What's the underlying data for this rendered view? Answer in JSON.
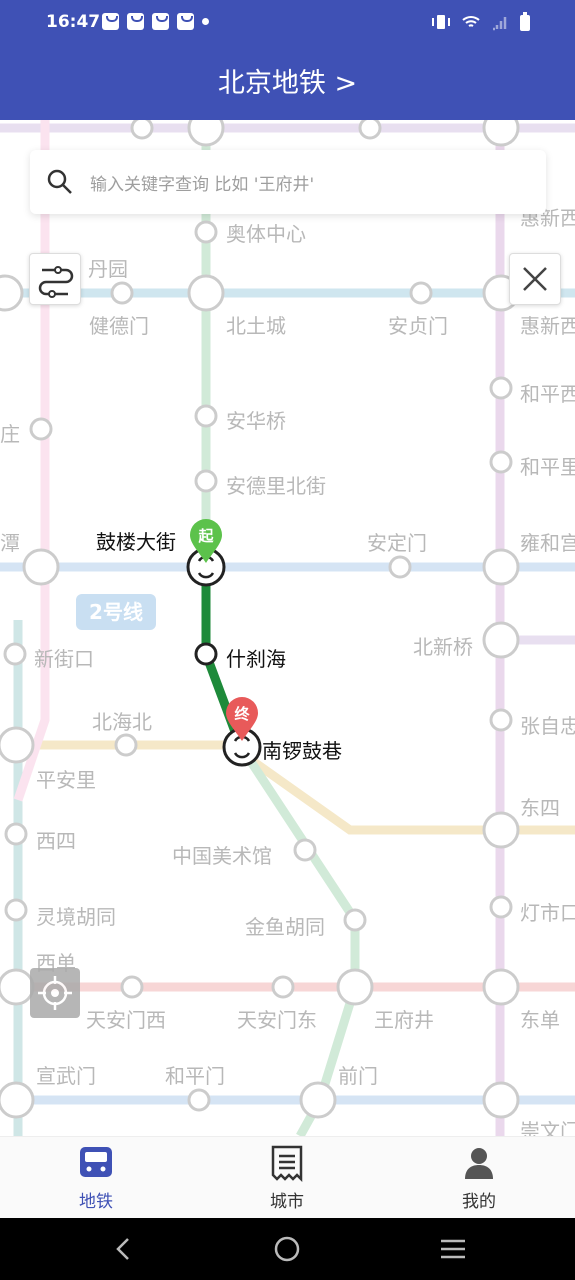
{
  "status": {
    "time": "16:47"
  },
  "header": {
    "title": "北京地铁 >"
  },
  "search": {
    "placeholder": "输入关键字查询 比如 '王府井'"
  },
  "line_badge": "2号线",
  "route": {
    "start_tag": "起",
    "end_tag": "终",
    "start": "鼓楼大街",
    "middle": "什刹海",
    "end": "南锣鼓巷"
  },
  "stations": {
    "aotizhongxin": "奥体中心",
    "mudanyuan": "丹园",
    "jiandemen": "健德门",
    "beitucheng": "北土城",
    "anzhenmen": "安贞门",
    "huixinxi": "惠新西",
    "huixindong": "惠新西",
    "anhuaqiao": "安华桥",
    "heping1": "和平西",
    "heping2": "和平里",
    "zhuang": "庄",
    "andelibeijie": "安德里北街",
    "tan": "潭",
    "andingmen": "安定门",
    "yonghegong": "雍和宫",
    "xinjiekou": "新街口",
    "beixinqiao": "北新桥",
    "beihaibei": "北海北",
    "zhangzizhong": "张自忠",
    "pinganli": "平安里",
    "dongsi": "东四",
    "xisi": "西四",
    "meishuguan": "中国美术馆",
    "lingjing": "灵境胡同",
    "jinyu": "金鱼胡同",
    "dengshikou": "灯市口",
    "xidan": "西单",
    "tiananmenxi": "天安门西",
    "tiananmendong": "天安门东",
    "wangfujing": "王府井",
    "dongdan": "东单",
    "xuanwumen": "宣武门",
    "hepingmen": "和平门",
    "qianmen": "前门",
    "chongwen": "崇文门"
  },
  "nav": {
    "tab1": "地铁",
    "tab2": "城市",
    "tab3": "我的"
  },
  "colors": {
    "primary": "#3f51b5",
    "route": "#1e8a3a",
    "start_pin": "#5cc24b",
    "end_pin": "#e85a5a"
  }
}
